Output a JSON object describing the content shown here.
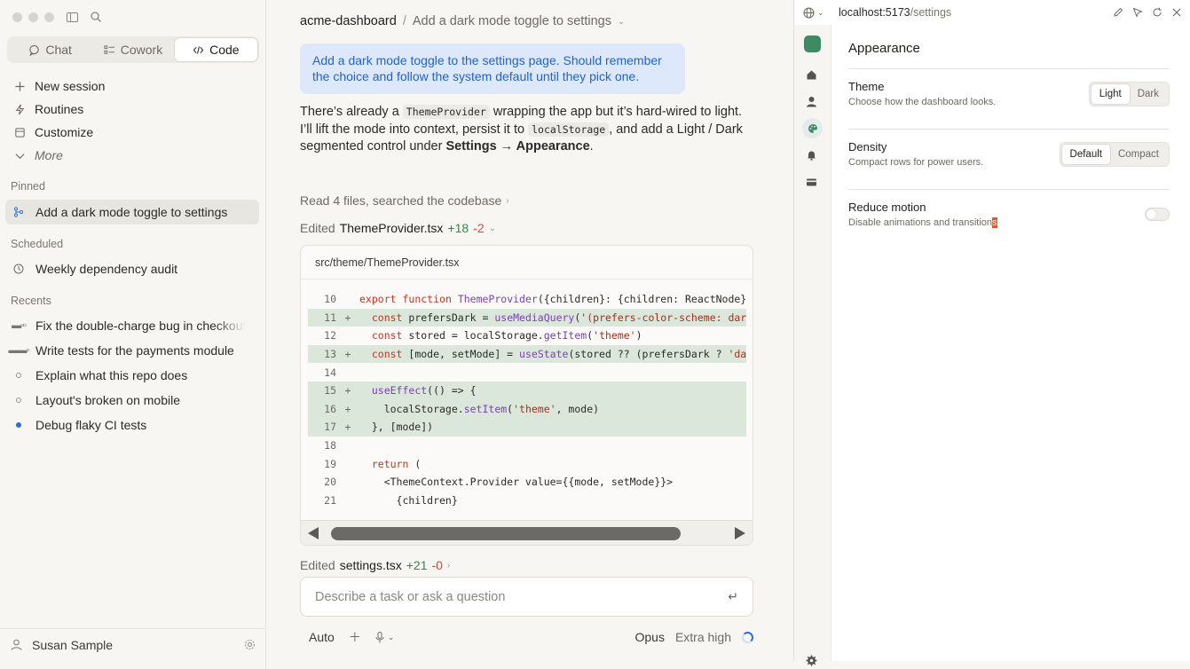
{
  "sidebar": {
    "mode_tabs": [
      {
        "label": "Chat",
        "active": false
      },
      {
        "label": "Cowork",
        "active": false
      },
      {
        "label": "Code",
        "active": true
      }
    ],
    "nav": {
      "new_session": "New session",
      "routines": "Routines",
      "customize": "Customize",
      "more": "More"
    },
    "pinned_label": "Pinned",
    "pinned": [
      "Add a dark mode toggle to settings"
    ],
    "scheduled_label": "Scheduled",
    "scheduled": [
      "Weekly dependency audit"
    ],
    "recents_label": "Recents",
    "recents": [
      "Fix the double-charge bug in checkout",
      "Write tests for the payments module",
      "Explain what this repo does",
      "Layout's broken on mobile",
      "Debug flaky CI tests"
    ],
    "user_name": "Susan Sample"
  },
  "main": {
    "breadcrumb": {
      "repo": "acme-dashboard",
      "separator": "/",
      "task": "Add a dark mode toggle to settings"
    },
    "user_message": "Add a dark mode toggle to the settings page. Should remember the choice and follow the system default until they pick one.",
    "reply": {
      "p1": "There’s already a ",
      "code1": "ThemeProvider",
      "p2": " wrapping the app but it’s hard-wired to light. I’ll lift the mode into context, persist it to ",
      "code2": "localStorage",
      "p3": ", and add a Light / Dark segmented control under ",
      "bold": "Settings → Appearance",
      "p4": "."
    },
    "activity": "Read 4 files, searched the codebase",
    "edit1": {
      "prefix": "Edited",
      "file": "ThemeProvider.tsx",
      "added": "+18",
      "removed": "-2"
    },
    "code_path": "src/theme/ThemeProvider.tsx",
    "code_lines": [
      {
        "n": "10",
        "mark": "",
        "added": false,
        "text": "export function ThemeProvider({children}: {children: ReactNode}) {"
      },
      {
        "n": "11",
        "mark": "+",
        "added": true,
        "text": "  const prefersDark = useMediaQuery('(prefers-color-scheme: dark)')"
      },
      {
        "n": "12",
        "mark": "",
        "added": false,
        "text": "  const stored = localStorage.getItem('theme')"
      },
      {
        "n": "13",
        "mark": "+",
        "added": true,
        "text": "  const [mode, setMode] = useState(stored ?? (prefersDark ? 'dark' :"
      },
      {
        "n": "14",
        "mark": "",
        "added": false,
        "text": ""
      },
      {
        "n": "15",
        "mark": "+",
        "added": true,
        "text": "  useEffect(() => {"
      },
      {
        "n": "16",
        "mark": "+",
        "added": true,
        "text": "    localStorage.setItem('theme', mode)"
      },
      {
        "n": "17",
        "mark": "+",
        "added": true,
        "text": "  }, [mode])"
      },
      {
        "n": "18",
        "mark": "",
        "added": false,
        "text": ""
      },
      {
        "n": "19",
        "mark": "",
        "added": false,
        "text": "  return ("
      },
      {
        "n": "20",
        "mark": "",
        "added": false,
        "text": "    <ThemeContext.Provider value={{mode, setMode}}>"
      },
      {
        "n": "21",
        "mark": "",
        "added": false,
        "text": "      {children}"
      }
    ],
    "edit2": {
      "prefix": "Edited",
      "file": "settings.tsx",
      "added": "+21",
      "removed": "-0"
    },
    "composer_placeholder": "Describe a task or ask a question",
    "toolbar": {
      "mode": "Auto",
      "model": "Opus",
      "effort": "Extra high"
    }
  },
  "preview": {
    "url_host": "localhost:5173",
    "url_path": "/settings",
    "section_title": "Appearance",
    "settings": [
      {
        "name": "Theme",
        "desc": "Choose how the dashboard looks.",
        "options": [
          "Light",
          "Dark"
        ],
        "selected": "Light"
      },
      {
        "name": "Density",
        "desc": "Compact rows for power users.",
        "options": [
          "Default",
          "Compact"
        ],
        "selected": "Default"
      },
      {
        "name": "Reduce motion",
        "desc_main": "Disable animations and transition",
        "desc_tail": "s",
        "toggle_on": false
      }
    ]
  }
}
